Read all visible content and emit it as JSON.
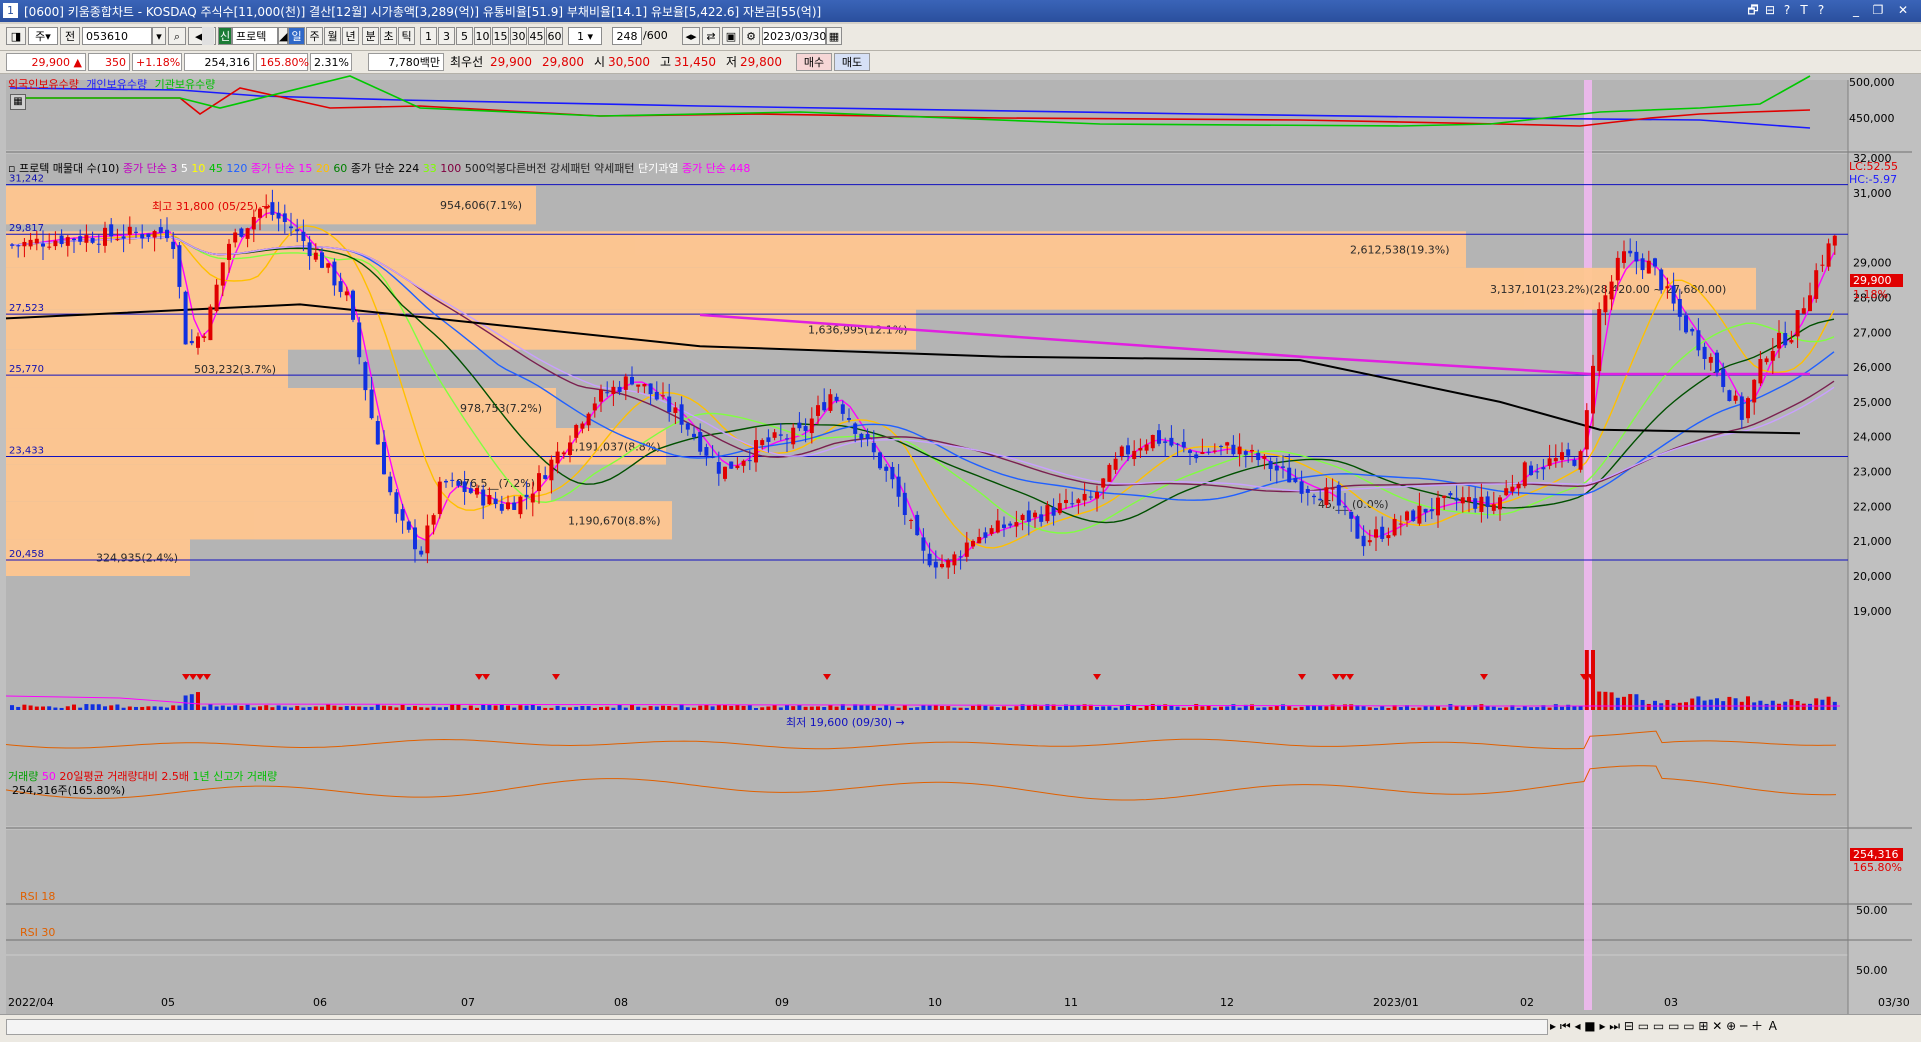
{
  "window": {
    "title": "[0600] 키움종합차트 - KOSDAQ 주식수[11,000(천)] 결산[12월] 시가총액[3,289(억)] 유통비율[51.9] 부채비율[14.1] 유보율[5,422.6] 자본금[55(억)]",
    "icon_label": "1",
    "controls": [
      "🗗",
      "⊟",
      "?",
      "T",
      "?",
      "_",
      "❐",
      "✕"
    ]
  },
  "toolbar": {
    "period_select": "주",
    "all_label": "전",
    "code": "053610",
    "stock_tag": "신",
    "stock_name": "프로텍",
    "periods": [
      "일",
      "주",
      "월",
      "년",
      "분",
      "초",
      "틱"
    ],
    "minutes": [
      "1",
      "3",
      "5",
      "10",
      "15",
      "30",
      "45",
      "60"
    ],
    "minute_select": "1",
    "count": "248",
    "count_total": "/600",
    "date": "2023/03/30"
  },
  "quote": {
    "price": "29,900",
    "updown_icon": "▲",
    "change": "350",
    "change_pct": "+1.18%",
    "volume": "254,316",
    "volume_ratio": "165.80%",
    "turnover": "2.31%",
    "trade_value": "7,780백만",
    "best_label": "최우선",
    "best_ask": "29,900",
    "best_bid": "29,800",
    "high_label": "시",
    "open": "30,500",
    "h_label": "고",
    "high": "31,450",
    "l_label": "저",
    "low": "29,800",
    "buy": "매수",
    "sell": "매도"
  },
  "top_panel": {
    "legend": [
      "외국인보유수량",
      "개인보유수량",
      "기관보유수량"
    ],
    "legend_colors": [
      "#e00000",
      "#1a1aff",
      "#00c800"
    ],
    "axis": [
      "500,000",
      "450,000"
    ]
  },
  "price_panel": {
    "legend": [
      {
        "t": "프로텍 매물대 수(10)",
        "c": "#000000"
      },
      {
        "t": "종가 단순 3",
        "c": "#c000c0"
      },
      {
        "t": "5",
        "c": "#ffffff"
      },
      {
        "t": "10",
        "c": "#ffff00"
      },
      {
        "t": "45",
        "c": "#00c000"
      },
      {
        "t": "120",
        "c": "#2060ff"
      },
      {
        "t": "종가 단순 15",
        "c": "#ff00ff"
      },
      {
        "t": "20",
        "c": "#ffc000"
      },
      {
        "t": "60",
        "c": "#008000"
      },
      {
        "t": "종가 단순 224",
        "c": "#000000"
      },
      {
        "t": "33",
        "c": "#80ff00"
      },
      {
        "t": "100",
        "c": "#800040"
      },
      {
        "t": "500억봉다른버전 강세패턴",
        "c": "#202020"
      },
      {
        "t": "약세패턴",
        "c": "#202020"
      },
      {
        "t": "단기과열",
        "c": "#ffffff"
      },
      {
        "t": "종가 단순 448",
        "c": "#ff00ff"
      }
    ],
    "lc": "LC:52.55",
    "hc": "HC:-5.97",
    "axis": [
      "32,000",
      "31,000",
      "29,000",
      "28,000",
      "27,000",
      "26,000",
      "25,000",
      "24,000",
      "23,000",
      "22,000",
      "21,000",
      "20,000",
      "19,000"
    ],
    "current_price": "29,900",
    "current_pct": "1.18%",
    "levels": [
      "31,242",
      "29,817",
      "27,523",
      "25,770",
      "23,433",
      "20,458"
    ],
    "high_note": "최고 31,800 (05/25)",
    "low_note": "최저 19,600 (09/30)",
    "volume_profile": [
      "954,606(7.1%)",
      "2,612,538(19.3%)",
      "3,137,101(23.2%)(28,420.00 ~ 27,680.00)",
      "1,636,995(12.1%)",
      "503,232(3.7%)",
      "978,753(7.2%)",
      "1,191,037(8.8%)",
      "976,5__(7.2%)",
      "1,190,670(8.8%)",
      "324,935(2.4%)",
      "45,___(0.0%)"
    ]
  },
  "volume_panel": {
    "legend": [
      {
        "t": "거래량",
        "c": "#00c000"
      },
      {
        "t": "50",
        "c": "#ff00ff"
      },
      {
        "t": "20일평균 거래량대비 2.5배",
        "c": "#e00000"
      },
      {
        "t": "1년 신고가 거래량",
        "c": "#00c000"
      }
    ],
    "value_text": "254,316주(165.80%)",
    "current": "254,316",
    "current_pct": "165.80%"
  },
  "rsi18": {
    "label": "RSI 18",
    "axis": "50.00"
  },
  "rsi30": {
    "label": "RSI 30",
    "axis": "50.00"
  },
  "dates": [
    "2022/04",
    "05",
    "06",
    "07",
    "08",
    "09",
    "10",
    "11",
    "12",
    "2023/01",
    "02",
    "03",
    "03/30"
  ]
}
